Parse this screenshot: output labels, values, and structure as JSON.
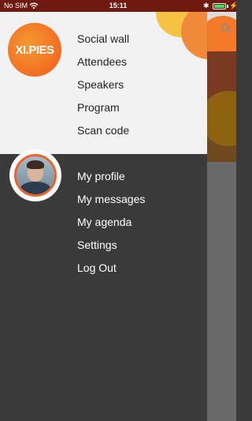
{
  "status_bar": {
    "carrier": "No SIM",
    "time": "15:11",
    "bluetooth_symbol": "✱",
    "charge_symbol": "⚡"
  },
  "brand": {
    "logo_text": "XI.PIES"
  },
  "menu": {
    "top": [
      {
        "label": "Social wall"
      },
      {
        "label": "Attendees"
      },
      {
        "label": "Speakers"
      },
      {
        "label": "Program"
      },
      {
        "label": "Scan code"
      }
    ],
    "bottom": [
      {
        "label": "My profile"
      },
      {
        "label": "My messages"
      },
      {
        "label": "My agenda"
      },
      {
        "label": "Settings"
      },
      {
        "label": "Log Out"
      }
    ]
  },
  "colors": {
    "status_bar": "#6e1a10",
    "drawer_top": "#f2f2f2",
    "drawer_bottom": "#3a3a3a",
    "accent": "#f0622a"
  },
  "icons": [
    "wifi-icon",
    "bluetooth-icon",
    "battery-icon",
    "search-icon",
    "avatar"
  ]
}
